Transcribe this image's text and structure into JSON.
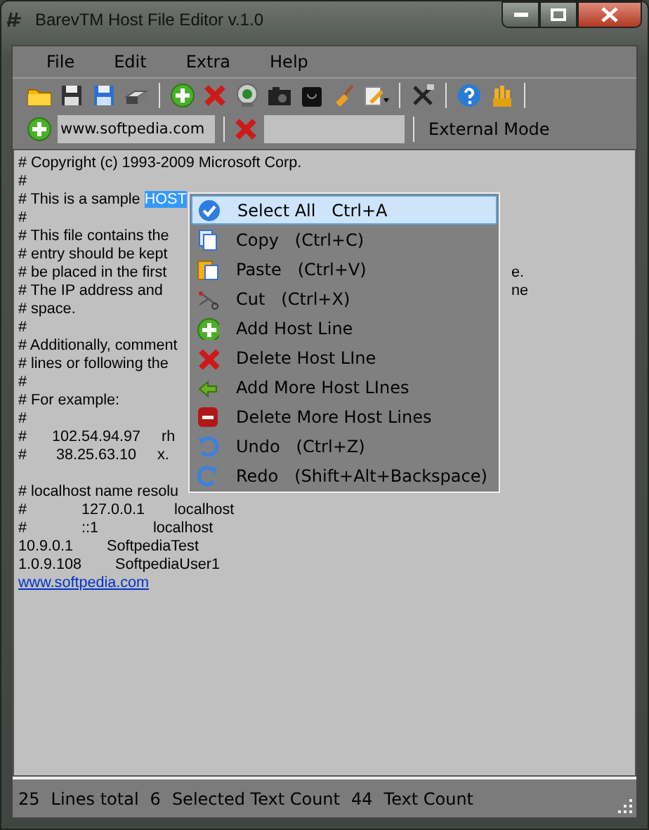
{
  "window": {
    "title": "BarevTM Host File Editor v.1.0"
  },
  "menu_bar": [
    {
      "label": "File"
    },
    {
      "label": "Edit"
    },
    {
      "label": "Extra"
    },
    {
      "label": "Help"
    }
  ],
  "toolbar": [
    {
      "kind": "folder"
    },
    {
      "kind": "floppy"
    },
    {
      "kind": "floppy-blue"
    },
    {
      "kind": "printer"
    },
    {
      "kind": "separator"
    },
    {
      "kind": "add"
    },
    {
      "kind": "delete"
    },
    {
      "kind": "webcam"
    },
    {
      "kind": "camera"
    },
    {
      "kind": "bag"
    },
    {
      "kind": "broom"
    },
    {
      "kind": "notepad"
    },
    {
      "kind": "separator"
    },
    {
      "kind": "tools"
    },
    {
      "kind": "separator"
    },
    {
      "kind": "help"
    },
    {
      "kind": "hand"
    },
    {
      "kind": "separator"
    }
  ],
  "address_bar": {
    "host_value": "www.softpedia.com",
    "mode": "External Mode"
  },
  "editor": {
    "lines": [
      {
        "kind": "text",
        "text": "# Copyright (c) 1993-2009 Microsoft Corp."
      },
      {
        "kind": "text",
        "text": "#"
      },
      {
        "kind": "text",
        "text": "# This is a sample ",
        "selection": "HOST"
      },
      {
        "kind": "text",
        "text": "#"
      },
      {
        "kind": "text",
        "text": "# This file contains the"
      },
      {
        "kind": "text",
        "text": "# entry should be kept"
      },
      {
        "kind": "text",
        "text": "# be placed in the first",
        "tail": "e."
      },
      {
        "kind": "text",
        "text": "# The IP address and",
        "tail": "ne"
      },
      {
        "kind": "text",
        "text": "# space."
      },
      {
        "kind": "text",
        "text": "#"
      },
      {
        "kind": "text",
        "text": "# Additionally, comment"
      },
      {
        "kind": "text",
        "text": "# lines or following the"
      },
      {
        "kind": "text",
        "text": "#"
      },
      {
        "kind": "text",
        "text": "# For example:"
      },
      {
        "kind": "text",
        "text": "#"
      },
      {
        "kind": "text",
        "text": "#      102.54.94.97     rh"
      },
      {
        "kind": "text",
        "text": "#       38.25.63.10     x."
      },
      {
        "kind": "blank"
      },
      {
        "kind": "text",
        "text": "# localhost name resolu"
      },
      {
        "kind": "text",
        "text": "#             127.0.0.1       localhost"
      },
      {
        "kind": "text",
        "text": "#             ::1             localhost"
      },
      {
        "kind": "text",
        "text": "10.9.0.1        SoftpediaTest"
      },
      {
        "kind": "text",
        "text": "1.0.9.108        SoftpediaUser1"
      },
      {
        "kind": "link",
        "text": "www.softpedia.com"
      }
    ]
  },
  "context_menu": [
    {
      "label": "Select All   Ctrl+A",
      "selected": true
    },
    {
      "label": "Copy   (Ctrl+C)",
      "selected": false
    },
    {
      "label": "Paste   (Ctrl+V)",
      "selected": false
    },
    {
      "label": "Cut   (Ctrl+X)",
      "selected": false
    },
    {
      "label": "Add Host Line",
      "selected": false
    },
    {
      "label": "Delete Host LIne",
      "selected": false
    },
    {
      "label": "Add More Host LInes",
      "selected": false
    },
    {
      "label": "Delete More Host Lines",
      "selected": false
    },
    {
      "label": "Undo   (Ctrl+Z)",
      "selected": false
    },
    {
      "label": "Redo   (Shift+Alt+Backspace)",
      "selected": false
    }
  ],
  "status_bar": [
    {
      "count": "25",
      "label": "Lines total"
    },
    {
      "count": "6",
      "label": "Selected Text Count"
    },
    {
      "count": "44",
      "label": "Text Count"
    }
  ]
}
